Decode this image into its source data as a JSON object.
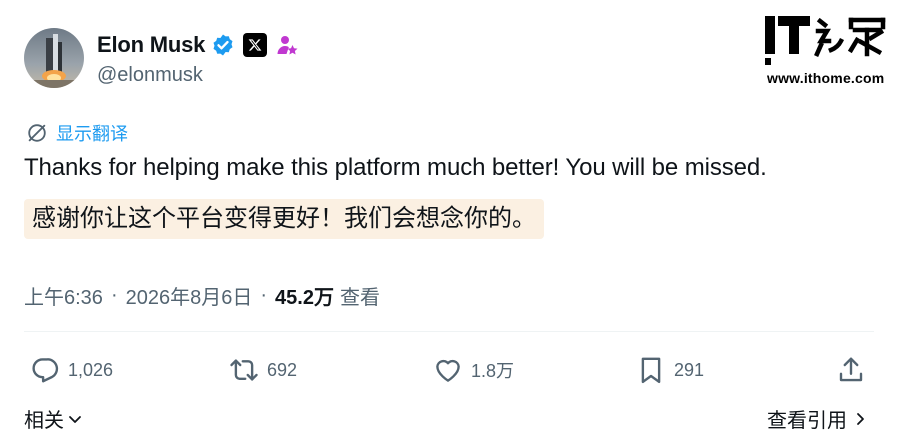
{
  "author": {
    "name": "Elon Musk",
    "handle": "@elonmusk",
    "verified_color": "#1d9bf0",
    "affiliation_color": "#c038d0"
  },
  "watermark": {
    "logo_text": "IT之家",
    "url": "www.ithome.com"
  },
  "translate": {
    "label": "显示翻译",
    "color": "#1d9bf0"
  },
  "tweet": {
    "text": "Thanks for helping make this platform much better! You will be missed.",
    "translation": "感谢你让这个平台变得更好！我们会想念你的。",
    "translation_bg": "#fbf0e2"
  },
  "meta": {
    "time": "上午6:36",
    "date": "2026年8月6日",
    "separator": "·",
    "views_count": "45.2万",
    "views_label": "查看"
  },
  "actions": {
    "replies": "1,026",
    "reposts": "692",
    "likes": "1.8万",
    "bookmarks": "291"
  },
  "footer": {
    "related_label": "相关",
    "quotes_label": "查看引用"
  },
  "icons": [
    "verified-badge-icon",
    "x-logo-icon",
    "affiliation-icon",
    "translate-icon",
    "reply-icon",
    "repost-icon",
    "like-icon",
    "bookmark-icon",
    "share-icon",
    "chevron-down-icon",
    "chevron-right-icon"
  ]
}
